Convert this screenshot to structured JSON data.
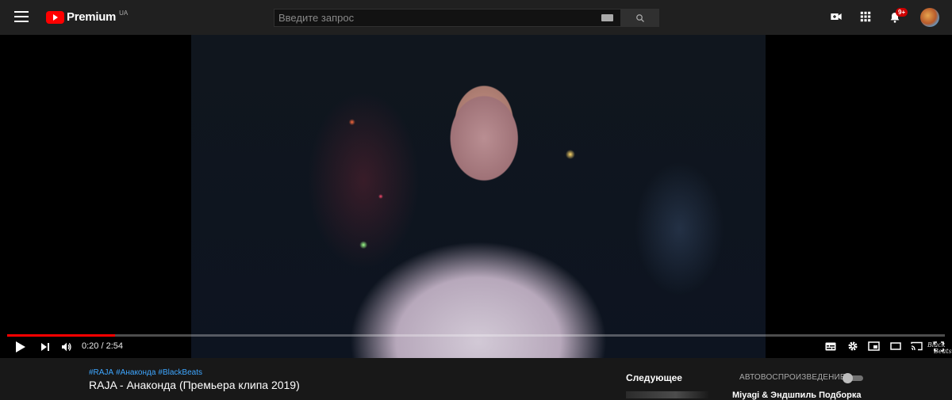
{
  "header": {
    "logo_text": "Premium",
    "region": "UA",
    "notifications_count": "9+"
  },
  "search": {
    "placeholder": "Введите запрос",
    "value": ""
  },
  "icons": {
    "menu": "hamburger-menu-icon",
    "search": "search-icon",
    "keyboard": "keyboard-icon",
    "create": "video-camera-plus-icon",
    "apps": "apps-grid-icon",
    "notifications": "bell-icon"
  },
  "player": {
    "current_time": "0:20 / 2:54",
    "progress_fraction": 0.115,
    "watermark_line1": "Black",
    "watermark_line2": "Beats"
  },
  "video": {
    "hashtags": [
      "#RAJA",
      "#Анаконда",
      "#BlackBeats"
    ],
    "title": "RAJA - Анаконда (Премьера клипа 2019)"
  },
  "sidebar": {
    "up_next_label": "Следующее",
    "autoplay_label": "АВТОВОСПРОИЗВЕДЕНИЕ",
    "autoplay_on": false,
    "next_video_title": "Miyagi & Эндшпиль Подборка"
  },
  "colors": {
    "accent": "#ff0000",
    "hashtag": "#3ea6ff",
    "background": "#181818",
    "topbar": "#202020"
  }
}
